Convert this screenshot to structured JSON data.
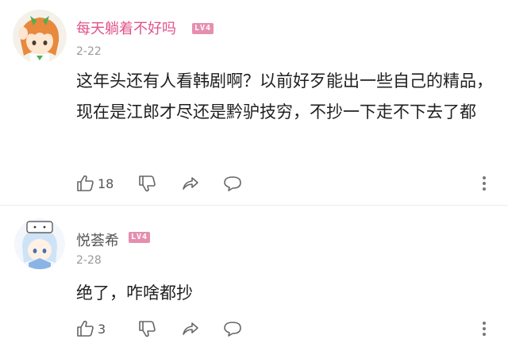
{
  "comments": [
    {
      "username": "每天躺着不好吗",
      "level": "LV4",
      "date": "2-22",
      "content": "这年头还有人看韩剧啊？以前好歹能出一些自己的精品，现在是江郎才尽还是黔驴技穷，不抄一下走不下去了都",
      "likes": "18",
      "name_color": "#e0528a"
    },
    {
      "username": "悦荟希",
      "level": "LV4",
      "date": "2-28",
      "content": "绝了，咋啥都抄",
      "likes": "3",
      "name_color": "#555555"
    }
  ],
  "icons": {
    "like": "thumbs-up-icon",
    "dislike": "thumbs-down-icon",
    "share": "share-icon",
    "reply": "comment-icon",
    "more": "more-vertical-icon"
  }
}
